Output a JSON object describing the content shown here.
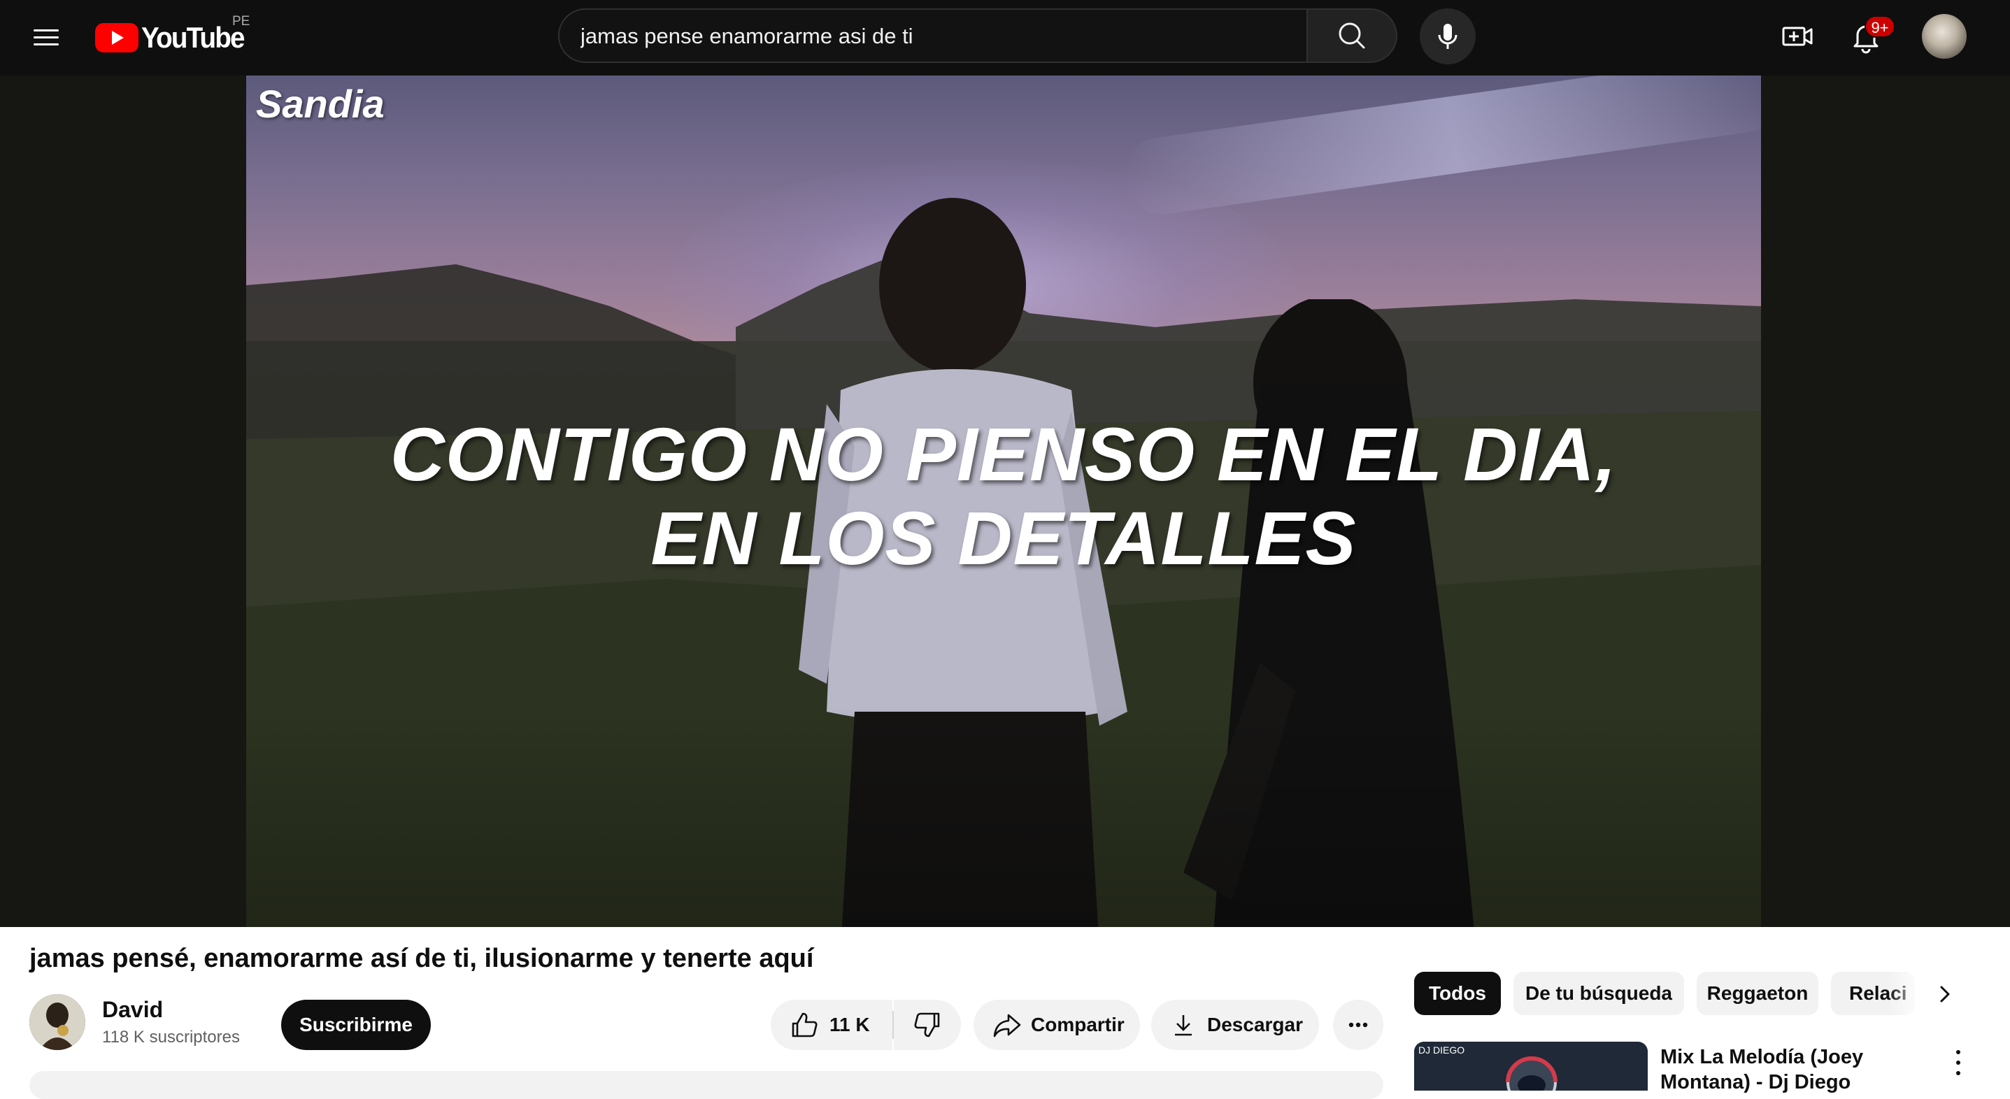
{
  "masthead": {
    "logo_text": "YouTube",
    "country_code": "PE",
    "search_value": "jamas pense enamorarme asi de ti",
    "notification_badge": "9+",
    "icons": [
      "menu-icon",
      "search-icon",
      "mic-icon",
      "create-icon",
      "bell-icon"
    ]
  },
  "video": {
    "watermark": "Sandia",
    "subtitle_line1": "CONTIGO NO PIENSO EN EL DIA,",
    "subtitle_line2": "EN LOS DETALLES"
  },
  "details": {
    "title": "jamas pensé, enamorarme así de ti, ilusionarme y tenerte aquí",
    "channel_name": "David",
    "subscribers": "118 K suscriptores",
    "subscribe_label": "Suscribirme",
    "like_count": "11 K",
    "share_label": "Compartir",
    "download_label": "Descargar"
  },
  "sidebar": {
    "chips": [
      {
        "label": "Todos",
        "active": true
      },
      {
        "label": "De tu búsqueda",
        "active": false
      },
      {
        "label": "Reggaeton",
        "active": false
      },
      {
        "label": "Relaci",
        "active": false
      }
    ],
    "recommendation": {
      "thumb_label": "DJ DIEGO",
      "title": "Mix La Melodía (Joey Montana) - Dj Diego"
    }
  },
  "colors": {
    "masthead_bg": "#0f0f0f",
    "brand_red": "#ff0000",
    "badge_red": "#cc0000",
    "pill_bg": "#f2f2f2"
  }
}
